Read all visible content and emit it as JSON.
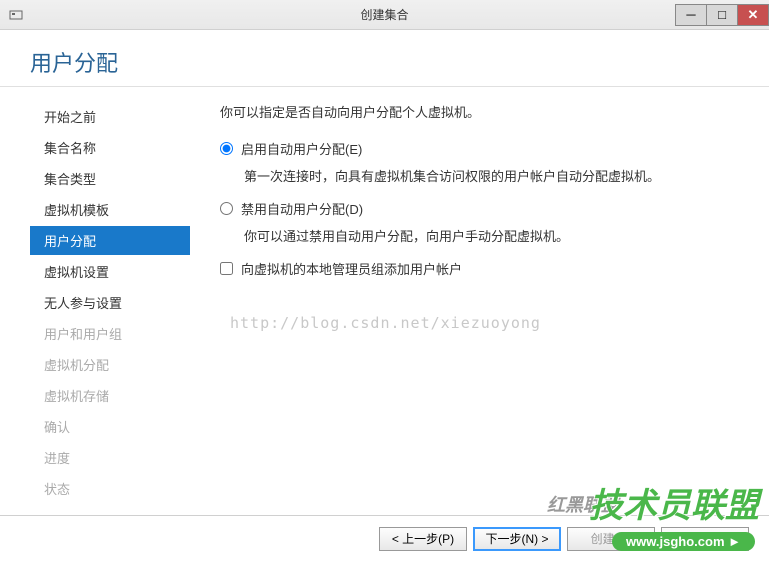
{
  "titlebar": {
    "title": "创建集合"
  },
  "header": {
    "heading": "用户分配"
  },
  "sidebar": {
    "items": [
      {
        "label": "开始之前",
        "state": "normal"
      },
      {
        "label": "集合名称",
        "state": "normal"
      },
      {
        "label": "集合类型",
        "state": "normal"
      },
      {
        "label": "虚拟机模板",
        "state": "normal"
      },
      {
        "label": "用户分配",
        "state": "active"
      },
      {
        "label": "虚拟机设置",
        "state": "normal"
      },
      {
        "label": "无人参与设置",
        "state": "normal"
      },
      {
        "label": "用户和用户组",
        "state": "disabled"
      },
      {
        "label": "虚拟机分配",
        "state": "disabled"
      },
      {
        "label": "虚拟机存储",
        "state": "disabled"
      },
      {
        "label": "确认",
        "state": "disabled"
      },
      {
        "label": "进度",
        "state": "disabled"
      },
      {
        "label": "状态",
        "state": "disabled"
      }
    ]
  },
  "main": {
    "description": "你可以指定是否自动向用户分配个人虚拟机。",
    "option1": {
      "label": "启用自动用户分配(E)",
      "desc": "第一次连接时，向具有虚拟机集合访问权限的用户帐户自动分配虚拟机。"
    },
    "option2": {
      "label": "禁用自动用户分配(D)",
      "desc": "你可以通过禁用自动用户分配，向用户手动分配虚拟机。"
    },
    "checkbox": {
      "label": "向虚拟机的本地管理员组添加用户帐户"
    },
    "watermark": "http://blog.csdn.net/xiezuoyong"
  },
  "footer": {
    "prev": "< 上一步(P)",
    "next": "下一步(N) >",
    "create": "创建(C)",
    "cancel": "取消"
  },
  "overlay": {
    "text": "技术员联盟",
    "subtext": "红黑联盟",
    "url": "www.jsgho.com"
  }
}
